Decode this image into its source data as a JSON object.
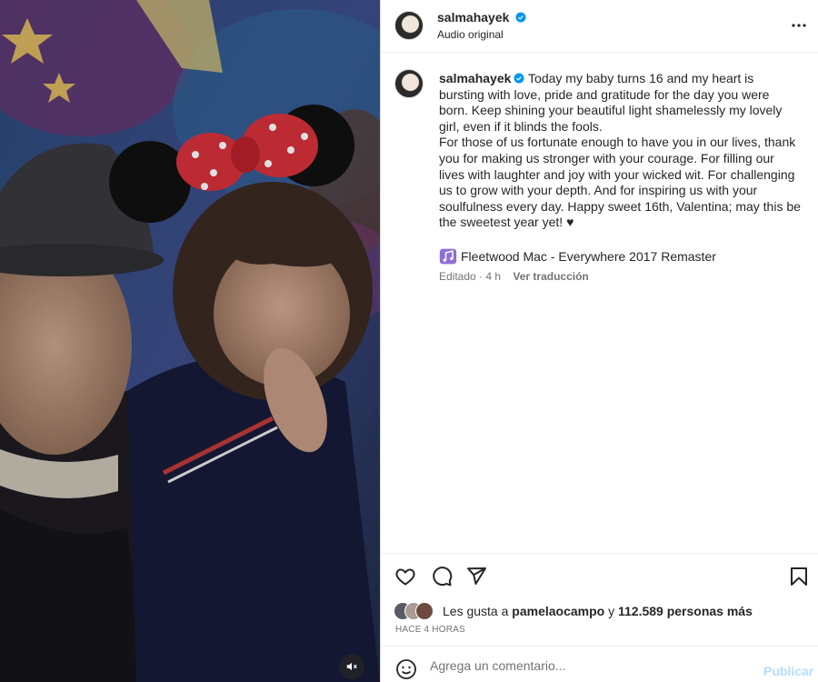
{
  "header": {
    "username": "salmahayek",
    "verified_icon": "verified-badge-icon",
    "subtitle": "Audio original"
  },
  "caption": {
    "username": "salmahayek",
    "paragraph1": "Today my baby turns 16 and my heart is bursting with love, pride and gratitude for the day you were born. Keep shining your beautiful light shamelessly my lovely girl, even if it blinds the fools.",
    "paragraph2": "For those of us fortunate enough to have you in our lives, thank you for making us stronger with your courage. For filling our lives with laughter and joy with your wicked wit. For challenging us to grow with your depth. And for inspiring us with your soulfulness every day. Happy sweet 16th, Valentina; may this be the sweetest year yet! ♥",
    "music": "Fleetwood Mac - Everywhere 2017 Remaster",
    "edited": "Editado · 4 h",
    "translate": "Ver traducción"
  },
  "likes": {
    "prefix": "Les gusta a",
    "user": "pamelaocampo",
    "connector": "y",
    "count": "112.589 personas más"
  },
  "timestamp": "HACE 4 HORAS",
  "comment": {
    "placeholder": "Agrega un comentario...",
    "post_label": "Publicar"
  },
  "colors": {
    "verified": "#0095f6",
    "post_disabled": "#b2dffc",
    "secondary_text": "#737373"
  },
  "icons": [
    "more-icon",
    "heart-icon",
    "comment-icon",
    "share-icon",
    "bookmark-icon",
    "emoji-icon",
    "muted-audio-icon",
    "music-note-icon"
  ]
}
